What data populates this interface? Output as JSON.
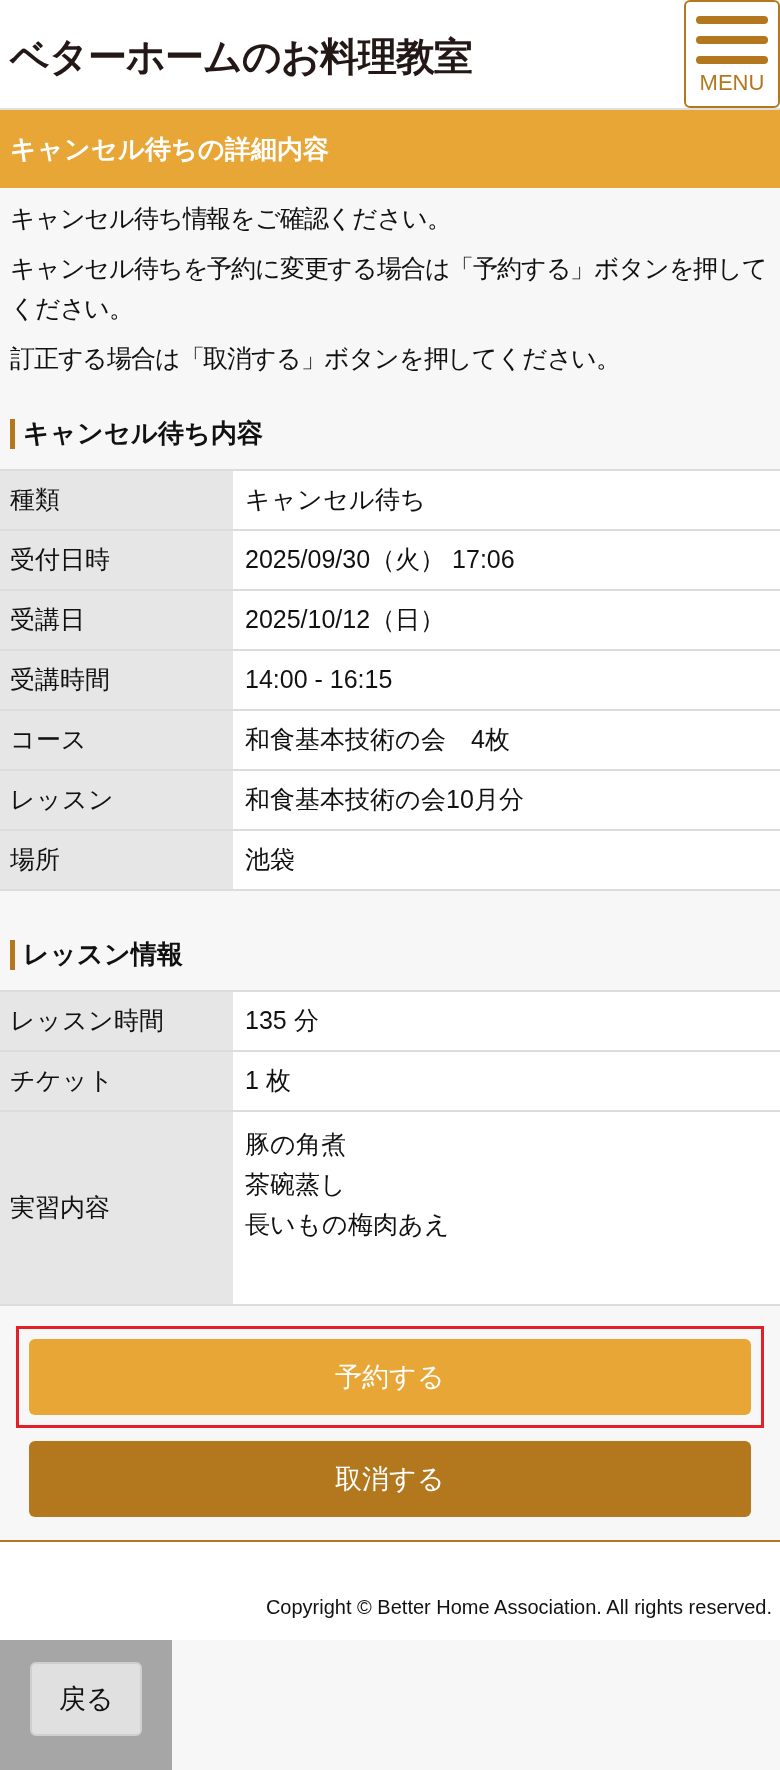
{
  "header": {
    "logo": "ベターホームのお料理教室",
    "menu_button": "MENU"
  },
  "page_title": "キャンセル待ちの詳細内容",
  "intro": [
    "キャンセル待ち情報をご確認ください。",
    "キャンセル待ちを予約に変更する場合は「予約する」ボタンを押してください。",
    "訂正する場合は「取消する」ボタンを押してください。"
  ],
  "sections": [
    {
      "heading": "キャンセル待ち内容",
      "rows": [
        {
          "label": "種類",
          "values": [
            "キャンセル待ち"
          ]
        },
        {
          "label": "受付日時",
          "values": [
            "2025/09/30（火） 17:06"
          ]
        },
        {
          "label": "受講日",
          "values": [
            "2025/10/12（日）"
          ]
        },
        {
          "label": "受講時間",
          "values": [
            "14:00 - 16:15"
          ]
        },
        {
          "label": "コース",
          "values": [
            "和食基本技術の会　4枚"
          ]
        },
        {
          "label": "レッスン",
          "values": [
            "和食基本技術の会10月分"
          ]
        },
        {
          "label": "場所",
          "values": [
            "池袋"
          ]
        }
      ]
    },
    {
      "heading": "レッスン情報",
      "rows": [
        {
          "label": "レッスン時間",
          "values": [
            "135 分"
          ]
        },
        {
          "label": "チケット",
          "values": [
            "1 枚"
          ]
        },
        {
          "label": "実習内容",
          "values": [
            "豚の角煮",
            "茶碗蒸し",
            "長いもの梅肉あえ"
          ]
        }
      ]
    }
  ],
  "buttons": [
    {
      "label": "予約する",
      "kind": "primary",
      "highlighted": true
    },
    {
      "label": "取消する",
      "kind": "secondary",
      "highlighted": false
    }
  ],
  "footer": {
    "copyright": "Copyright © Better Home Association. All rights reserved."
  },
  "back_button": "戻る"
}
